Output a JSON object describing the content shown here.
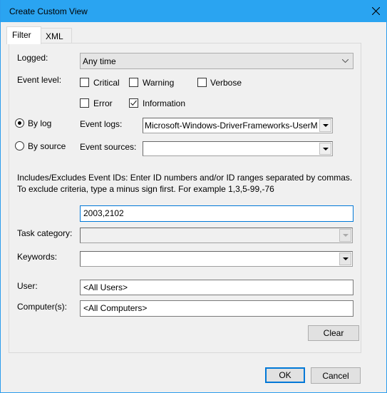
{
  "window": {
    "title": "Create Custom View"
  },
  "tabs": [
    {
      "label": "Filter",
      "active": true
    },
    {
      "label": "XML",
      "active": false
    }
  ],
  "filter": {
    "logged_label": "Logged:",
    "logged_value": "Any time",
    "event_level_label": "Event level:",
    "levels": [
      {
        "label": "Critical",
        "checked": false
      },
      {
        "label": "Warning",
        "checked": false
      },
      {
        "label": "Verbose",
        "checked": false
      },
      {
        "label": "Error",
        "checked": false
      },
      {
        "label": "Information",
        "checked": true
      }
    ],
    "by_log_label": "By log",
    "by_source_label": "By source",
    "selected_mode": "By log",
    "event_logs_label": "Event logs:",
    "event_logs_value": "Microsoft-Windows-DriverFrameworks-UserM",
    "event_sources_label": "Event sources:",
    "event_sources_value": "",
    "ids_help": "Includes/Excludes Event IDs: Enter ID numbers and/or ID ranges separated by commas. To exclude criteria, type a minus sign first. For example 1,3,5-99,-76",
    "ids_value": "2003,2102",
    "task_category_label": "Task category:",
    "task_category_value": "",
    "keywords_label": "Keywords:",
    "keywords_value": "",
    "user_label": "User:",
    "user_value": "<All Users>",
    "computer_label": "Computer(s):",
    "computer_value": "<All Computers>",
    "clear_label": "Clear"
  },
  "footer": {
    "ok_label": "OK",
    "cancel_label": "Cancel"
  },
  "colors": {
    "titlebar": "#2aa4f1",
    "focus": "#0078d7"
  }
}
